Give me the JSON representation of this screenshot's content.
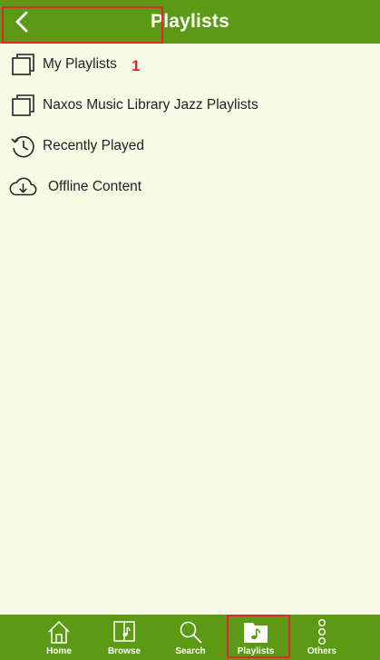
{
  "header": {
    "title": "Playlists"
  },
  "menu": [
    {
      "label": "My Playlists",
      "icon": "copy-squares-icon"
    },
    {
      "label": "Naxos Music Library Jazz Playlists",
      "icon": "copy-squares-icon"
    },
    {
      "label": "Recently Played",
      "icon": "history-clock-icon"
    },
    {
      "label": "Offline Content",
      "icon": "cloud-download-icon"
    }
  ],
  "annotation": {
    "number": "1"
  },
  "tabs": [
    {
      "label": "Home",
      "icon": "home-icon"
    },
    {
      "label": "Browse",
      "icon": "book-icon"
    },
    {
      "label": "Search",
      "icon": "search-icon"
    },
    {
      "label": "Playlists",
      "icon": "music-folder-icon",
      "active": true
    },
    {
      "label": "Others",
      "icon": "dots-vertical-icon"
    }
  ],
  "colors": {
    "brand_green": "#5c9a16",
    "background": "#f7fbe6",
    "annotation_red": "#e0262f"
  }
}
